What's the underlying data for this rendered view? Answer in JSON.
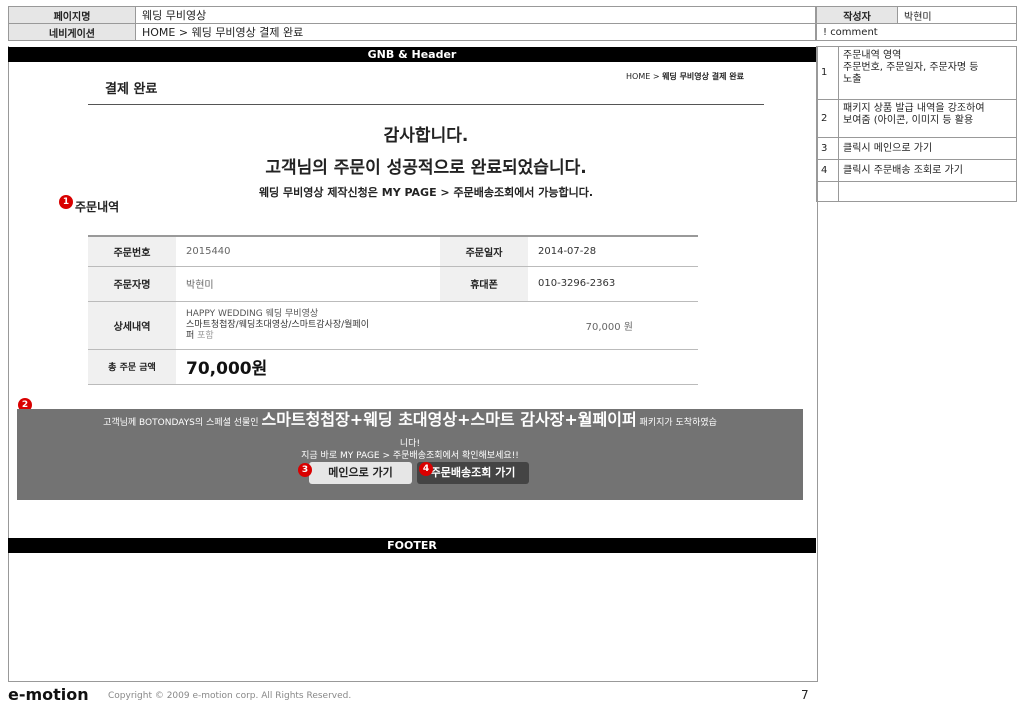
{
  "meta": {
    "page_name_label": "페이지명",
    "page_name": "웨딩 무비영상",
    "author_label": "작성자",
    "author": "박현미",
    "nav_label": "네비게이션",
    "nav_path": "HOME > 웨딩 무비영상 결제 완료",
    "comment_header": "! comment"
  },
  "gnb_label": "GNB & Header",
  "page": {
    "title": "결제 완료",
    "breadcrumb_home": "HOME >",
    "breadcrumb_current": "웨딩 무비영상 결제 완료",
    "thanks": "감사합니다.",
    "complete_msg": "고객님의 주문이 성공적으로 완료되었습니다.",
    "info_msg": "웨딩 무비영상 제작신청은 MY PAGE > 주문배송조회에서 가능합니다.",
    "section_title": "주문내역"
  },
  "order": {
    "order_no_label": "주문번호",
    "order_no": "2015440",
    "order_date_label": "주문일자",
    "order_date": "2014-07-28",
    "orderer_label": "주문자명",
    "orderer": "박현미",
    "phone_label": "휴대폰",
    "phone": "010-3296-2363",
    "detail_label": "상세내역",
    "detail_line1": "HAPPY WEDDING 웨딩 무비영상",
    "detail_line2": "스마트청첩장/웨딩초대영상/스마트감사장/월페이",
    "detail_line3": "퍼",
    "detail_include": "포함",
    "detail_price": "70,000 원",
    "total_label": "총 주문 금액",
    "total": "70,000원"
  },
  "promo": {
    "prefix": "고객님께 BOTONDAYS의 스페셜 선물인",
    "highlight": "스마트청첩장+웨딩 초대영상+스마트 감사장+월페이퍼",
    "suffix": "패키지가 도착하였습",
    "suffix2": "니다!",
    "line2": "지금 바로 MY PAGE > 주문배송조회에서 확인해보세요!!",
    "main_button": "메인으로 가기",
    "delivery_button": "주문배송조회 가기"
  },
  "footer_label": "FOOTER",
  "annotations": {
    "badge1": "1",
    "badge2": "2",
    "badge3": "3",
    "badge4": "4"
  },
  "comments": [
    {
      "num": "1",
      "lines": [
        "주문내역 영역",
        "주문번호, 주문일자, 주문자명 등",
        "노출"
      ]
    },
    {
      "num": "2",
      "lines": [
        "패키지 상품 발급 내역을 강조하여",
        "보여줌 (아이콘, 이미지 등 활용"
      ]
    },
    {
      "num": "3",
      "lines": [
        "클릭시 메인으로 가기"
      ]
    },
    {
      "num": "4",
      "lines": [
        "클릭시 주문배송 조회로 가기"
      ]
    }
  ],
  "bottom": {
    "logo": "e-motion",
    "copyright": "Copyright © 2009 e-motion corp. All Rights Reserved.",
    "page_number": "7"
  },
  "colors": {
    "badge_red": "#d90000",
    "promo_bg": "#737373",
    "black_bar": "#000000"
  }
}
